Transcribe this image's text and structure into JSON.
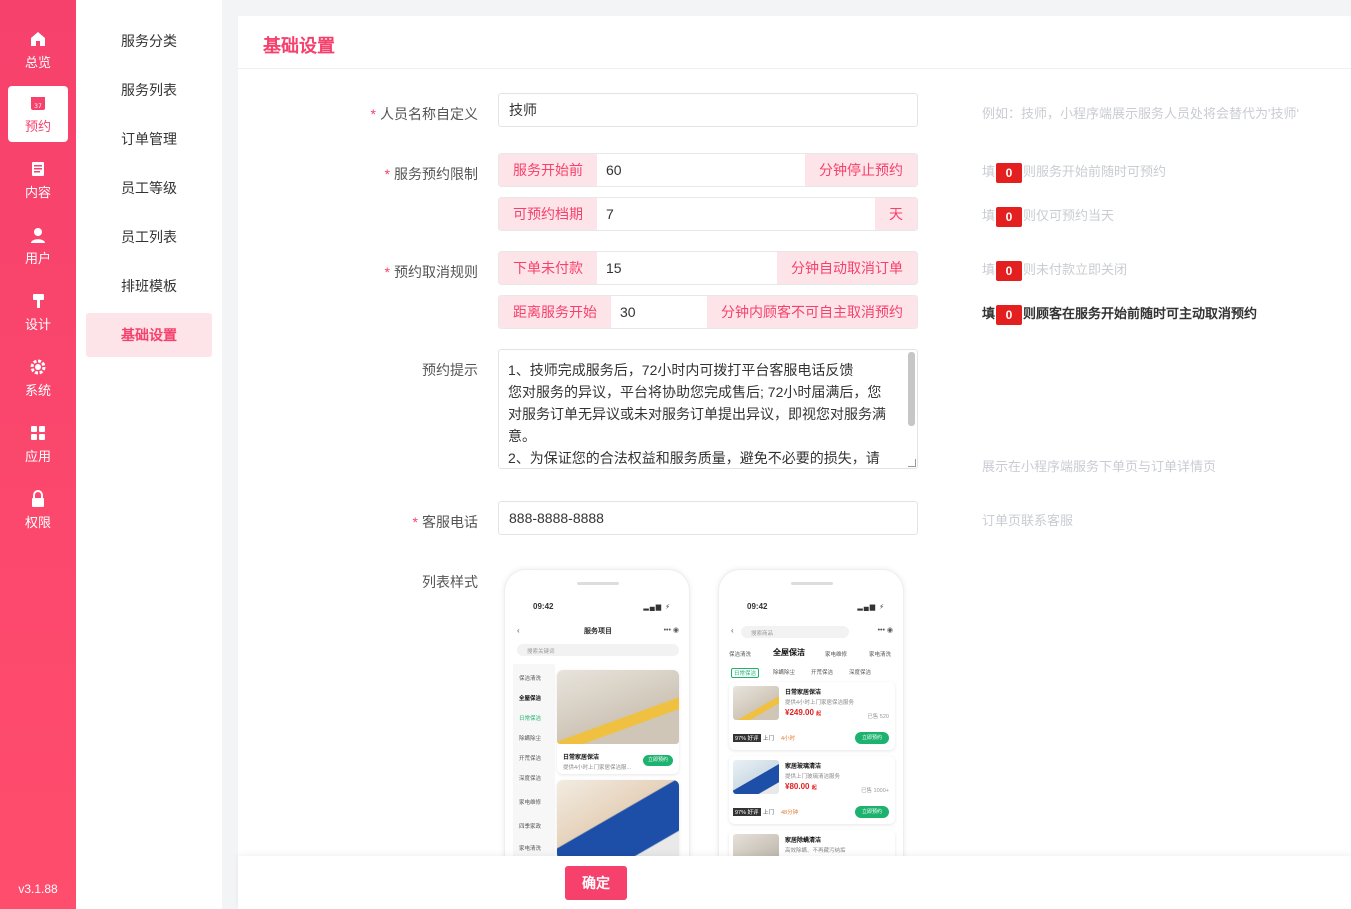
{
  "nav": {
    "items": [
      {
        "label": "总览",
        "icon": "home-icon"
      },
      {
        "label": "预约",
        "icon": "calendar-icon",
        "badge": "37"
      },
      {
        "label": "内容",
        "icon": "document-icon"
      },
      {
        "label": "用户",
        "icon": "user-icon"
      },
      {
        "label": "设计",
        "icon": "brush-icon"
      },
      {
        "label": "系统",
        "icon": "gear-icon"
      },
      {
        "label": "应用",
        "icon": "grid-icon"
      },
      {
        "label": "权限",
        "icon": "lock-icon"
      }
    ],
    "version": "v3.1.88"
  },
  "subnav": {
    "items": [
      "服务分类",
      "服务列表",
      "订单管理",
      "员工等级",
      "员工列表",
      "排班模板",
      "基础设置"
    ],
    "active": "基础设置"
  },
  "page": {
    "title": "基础设置"
  },
  "form": {
    "staff_name": {
      "label": "人员名称自定义",
      "value": "技师",
      "hint": "例如：技师，小程序端展示服务人员处将会替代为'技师'"
    },
    "booking_limit": {
      "label": "服务预约限制",
      "row1": {
        "prefix": "服务开始前",
        "value": "60",
        "suffix": "分钟停止预约",
        "hint_pre": "填",
        "hint_zero": "0",
        "hint_post": "则服务开始前随时可预约"
      },
      "row2": {
        "prefix": "可预约档期",
        "value": "7",
        "suffix": "天",
        "hint_pre": "填",
        "hint_zero": "0",
        "hint_post": "则仅可预约当天"
      }
    },
    "cancel_rule": {
      "label": "预约取消规则",
      "row1": {
        "prefix": "下单未付款",
        "value": "15",
        "suffix": "分钟自动取消订单",
        "hint_pre": "填",
        "hint_zero": "0",
        "hint_post": "则未付款立即关闭"
      },
      "row2": {
        "prefix": "距离服务开始",
        "value": "30",
        "suffix": "分钟内顾客不可自主取消预约",
        "hint_pre": "填",
        "hint_zero": "0",
        "hint_post": "则顾客在服务开始前随时可主动取消预约"
      }
    },
    "tips": {
      "label": "预约提示",
      "lines": [
        "1、技师完成服务后，72小时内可拨打平台客服电话反馈",
        "您对服务的异议，平台将协助您完成售后; 72小时届满后，您",
        "对服务订单无异议或未对服务订单提出异议，即视您对服务满",
        "意。",
        "2、为保证您的合法权益和服务质量，避免不必要的损失，请"
      ],
      "hint": "展示在小程序端服务下单页与订单详情页"
    },
    "service_phone": {
      "label": "客服电话",
      "value": "888-8888-8888",
      "hint": "订单页联系客服"
    },
    "list_style": {
      "label": "列表样式"
    }
  },
  "preview1": {
    "time": "09:42",
    "title": "服务项目",
    "search": "搜索关键词",
    "categories": [
      "保洁清洗",
      "全屋保洁",
      "日常保洁",
      "除螨除尘",
      "开荒保洁",
      "深度保洁",
      "家电维修",
      "四季家政",
      "家电清洗"
    ],
    "card_title": "日常家居保洁",
    "card_desc": "提供4小时上门家居保洁服...",
    "card_btn": "立即预约"
  },
  "preview2": {
    "time": "09:42",
    "search": "搜索商品",
    "tabs": [
      "保洁清洗",
      "全屋保洁",
      "家电维修",
      "家电清洗"
    ],
    "chips": [
      "日常保洁",
      "除螨除尘",
      "开荒保洁",
      "深度保洁"
    ],
    "items": [
      {
        "title": "日常家居保洁",
        "desc": "提供4小时上门家居保洁服务",
        "price": "¥249.00",
        "unit": "起",
        "sold": "已售 520",
        "rate": "97% 好评",
        "tag1": "上门",
        "tag2": "4小时",
        "btn": "立即预约"
      },
      {
        "title": "家居玻璃清洁",
        "desc": "提供上门玻璃清洁服务",
        "price": "¥80.00",
        "unit": "起",
        "sold": "已售 1000+",
        "rate": "97% 好评",
        "tag1": "上门",
        "tag2": "48分钟",
        "btn": "立即预约"
      },
      {
        "title": "家居除螨清洁",
        "desc": "高效除螨、不再藏污纳垢"
      }
    ]
  },
  "footer": {
    "confirm": "确定"
  },
  "colors": {
    "accent": "#f6416c",
    "accent_light": "#fde4e9",
    "zero_badge": "#e31f1f",
    "green": "#1db36f"
  }
}
